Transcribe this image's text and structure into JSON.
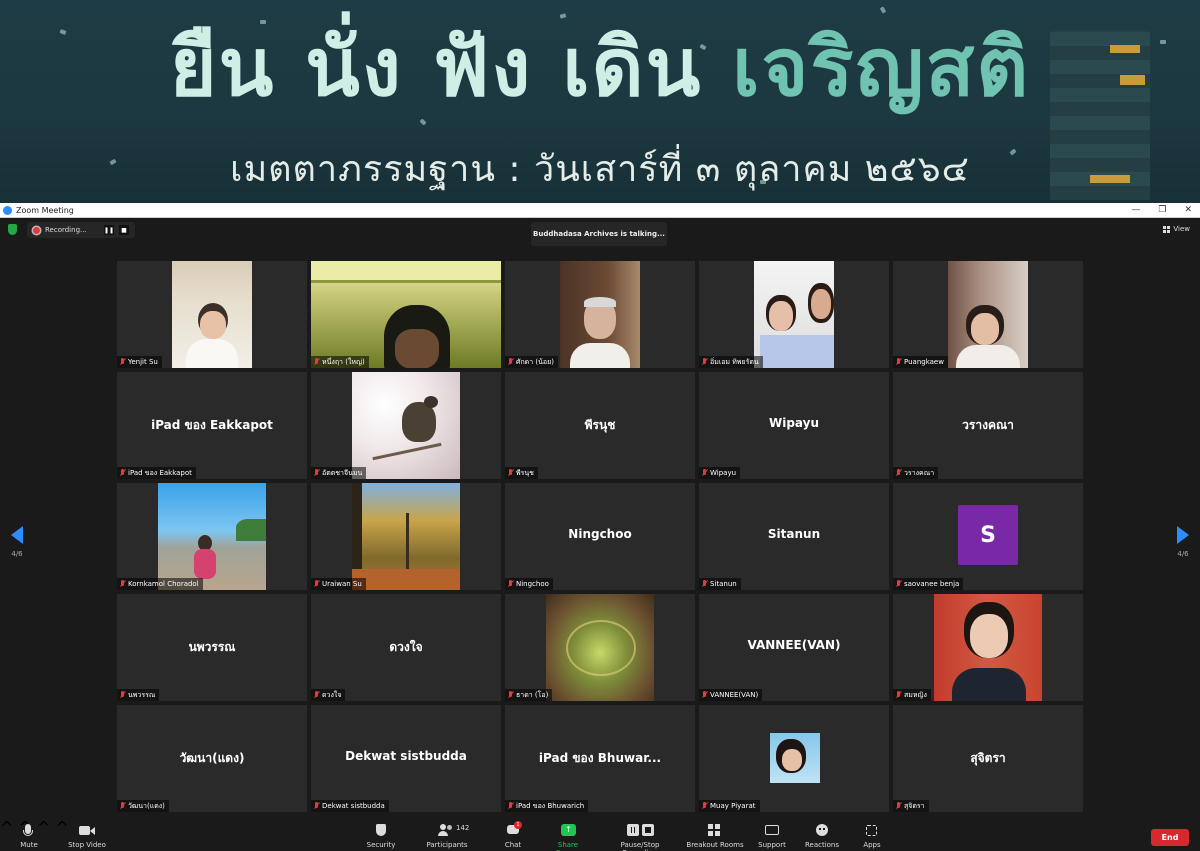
{
  "banner": {
    "title_main": "ยืน นั่ง ฟัง เดิน ",
    "title_accent": "เจริญสติ",
    "subtitle": "เมตตาภรรมฐาน : วันเสาร์ที่ ๓ ตุลาคม ๒๕๖๔",
    "colors": {
      "bg": "#1c3840",
      "title": "#cfeee6",
      "accent": "#6fc3b0"
    }
  },
  "window": {
    "title": "Zoom Meeting",
    "controls": [
      "—",
      "❐",
      "✕"
    ]
  },
  "topbar": {
    "recording_label": "Recording...",
    "pause_icon": "❚❚",
    "stop_icon": "■",
    "talking": "Buddhadasa Archives is talking...",
    "view_label": "View"
  },
  "pagination": {
    "left": "4/6",
    "right": "4/6"
  },
  "tiles": [
    {
      "name": "Yenjit Su"
    },
    {
      "name": "หนึ่งฤา (ใหญ่)"
    },
    {
      "name": "ศักดา (น้อย)"
    },
    {
      "name": "อิ่มเอม ทิพยรัตน"
    },
    {
      "name": "Puangkaew"
    },
    {
      "name": "iPad ของ Eakkapot",
      "center": "iPad ของ Eakkapot"
    },
    {
      "name": "อัตตชาจีนมน"
    },
    {
      "name": "พีรนุช",
      "center": "พีรนุช"
    },
    {
      "name": "Wipayu",
      "center": "Wipayu"
    },
    {
      "name": "วรางคณา",
      "center": "วรางคณา"
    },
    {
      "name": "Kornkamol Choradol"
    },
    {
      "name": "Uraiwan Su"
    },
    {
      "name": "Ningchoo",
      "center": "Ningchoo"
    },
    {
      "name": "Sitanun",
      "center": "Sitanun"
    },
    {
      "name": "saovanee benja",
      "avatar": "S"
    },
    {
      "name": "นพวรรณ",
      "center": "นพวรรณ"
    },
    {
      "name": "ดวงใจ",
      "center": "ดวงใจ"
    },
    {
      "name": "ธาดา (โอ)"
    },
    {
      "name": "VANNEE(VAN)",
      "center": "VANNEE(VAN)"
    },
    {
      "name": "สมหญิง"
    },
    {
      "name": "วัฒนา(แดง)",
      "center": "วัฒนา(แดง)"
    },
    {
      "name": "Dekwat sistbudda",
      "center": "Dekwat sistbudda"
    },
    {
      "name": "iPad ของ Bhuwarich",
      "center": "iPad ของ Bhuwar..."
    },
    {
      "name": "Muay Piyarat"
    },
    {
      "name": "สุจิตรา",
      "center": "สุจิตรา"
    }
  ],
  "toolbar": {
    "mute": "Mute",
    "stop_video": "Stop Video",
    "security": "Security",
    "participants": "Participants",
    "participants_count": "142",
    "chat": "Chat",
    "chat_badge": "1",
    "share_screen": "Share Screen",
    "pause_recording": "Pause/Stop Recording",
    "breakout": "Breakout Rooms",
    "support": "Support",
    "reactions": "Reactions",
    "apps": "Apps",
    "end": "End",
    "share_color": "#23c552"
  }
}
